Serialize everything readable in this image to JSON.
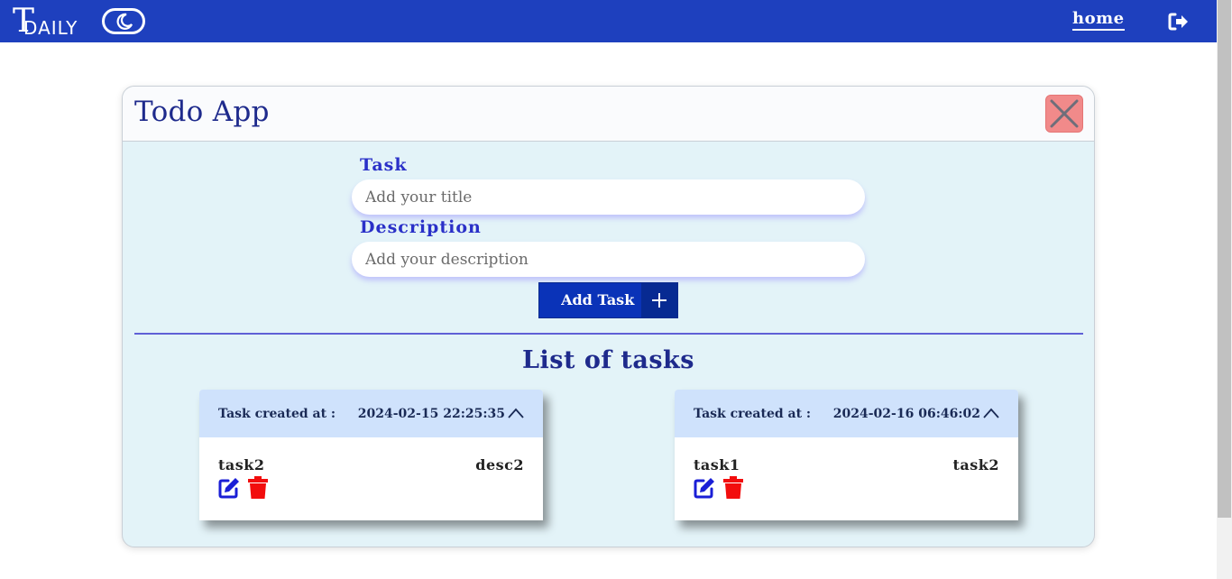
{
  "navbar": {
    "brand_letter": "T",
    "brand_text": "DAILY",
    "home_label": "home",
    "icons": {
      "theme": "moon-icon",
      "logout": "sign-out-icon"
    },
    "bg_color": "#1e40be"
  },
  "card": {
    "title": "Todo App",
    "close_icon": "close-icon"
  },
  "form": {
    "task_label": "Task",
    "task_placeholder": "Add your title",
    "task_value": "",
    "description_label": "Description",
    "description_placeholder": "Add your description",
    "description_value": "",
    "add_button_label": "Add Task",
    "add_icon": "plus-icon"
  },
  "list": {
    "title": "List of tasks",
    "created_label": "Task created at :",
    "tasks": [
      {
        "created_at": "2024-02-15 22:25:35",
        "title": "task2",
        "description": "desc2"
      },
      {
        "created_at": "2024-02-16 06:46:02",
        "title": "task1",
        "description": "task2"
      }
    ]
  },
  "colors": {
    "accent": "#2a30c8",
    "card_bg": "#e3f3f8",
    "task_header": "#cfe2fc",
    "delete": "#f20d0d",
    "edit": "#1a1ed6",
    "close_btn": "#f18a8a"
  }
}
